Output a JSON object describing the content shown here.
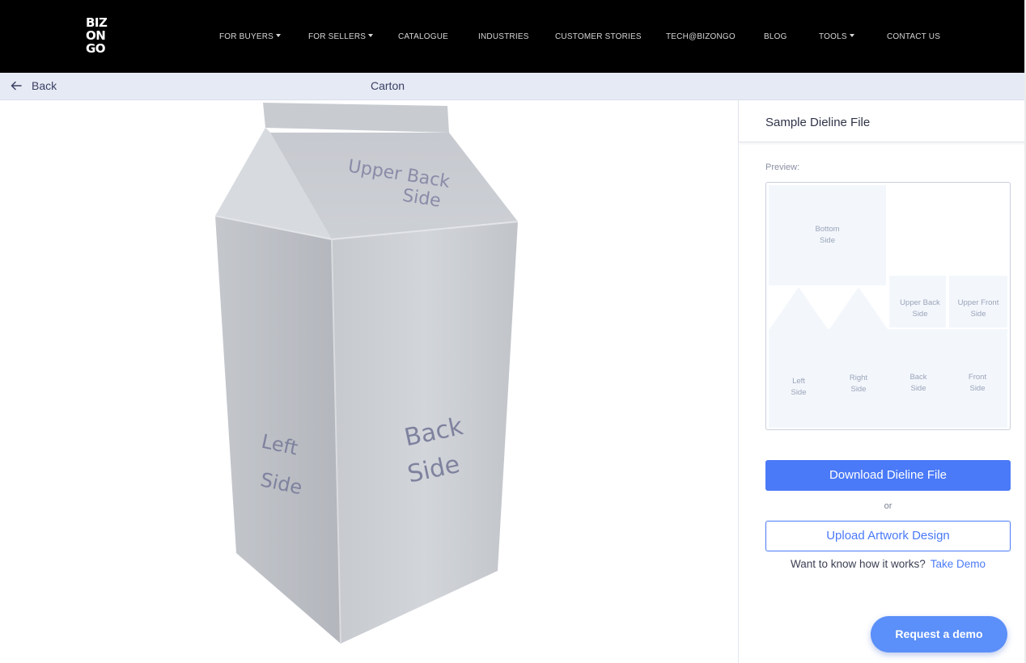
{
  "logo": {
    "lines": [
      "BIZ",
      "ON",
      "GO"
    ]
  },
  "nav": {
    "items": [
      {
        "label": "FOR BUYERS",
        "dropdown": true
      },
      {
        "label": "FOR SELLERS",
        "dropdown": true
      },
      {
        "label": "CATALOGUE",
        "dropdown": false
      },
      {
        "label": "INDUSTRIES",
        "dropdown": false
      },
      {
        "label": "CUSTOMER STORIES",
        "dropdown": false
      },
      {
        "label": "TECH@BIZONGO",
        "dropdown": false
      },
      {
        "label": "BLOG",
        "dropdown": false
      },
      {
        "label": "TOOLS",
        "dropdown": true
      },
      {
        "label": "CONTACT US",
        "dropdown": false
      }
    ]
  },
  "subheader": {
    "back_label": "Back",
    "title": "Carton"
  },
  "model": {
    "upper_back_line1": "Upper Back",
    "upper_back_line2": "Side",
    "left_line1": "Left",
    "left_line2": "Side",
    "back_line1": "Back",
    "back_line2": "Side"
  },
  "panel": {
    "title": "Sample Dieline File",
    "preview_label": "Preview:",
    "dieline": {
      "bottom": "Bottom\nSide",
      "upper_back": "Upper Back\nSide",
      "upper_front": "Upper Front\nSide",
      "left": "Left\nSide",
      "right": "Right\nSide",
      "back": "Back\nSide",
      "front": "Front\nSide"
    },
    "download_label": "Download Dieline File",
    "or_label": "or",
    "upload_label": "Upload Artwork Design",
    "howto_text": "Want to know how it works?",
    "take_demo_label": "Take Demo"
  },
  "request_demo_label": "Request a demo",
  "colors": {
    "accent": "#4a7af7",
    "nav_bg": "#000000",
    "subbar_bg": "#e6eaf4"
  }
}
